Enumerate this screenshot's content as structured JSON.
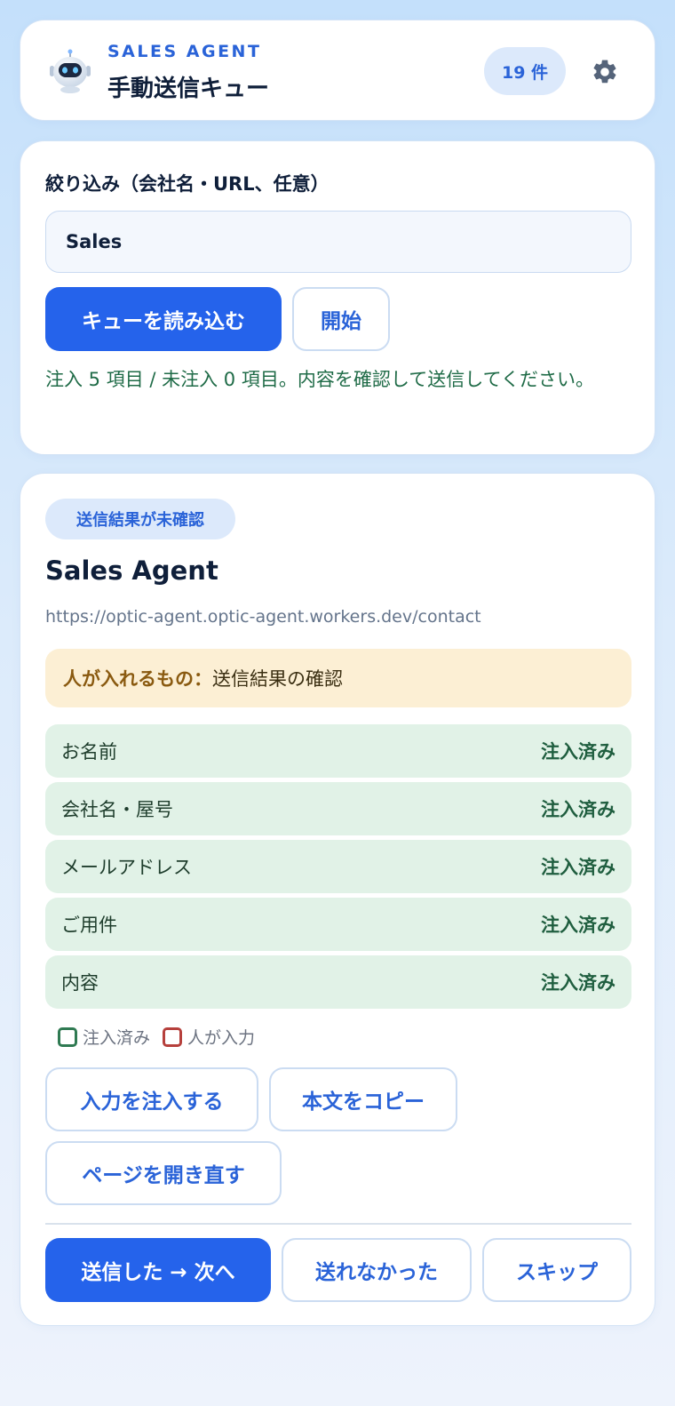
{
  "header": {
    "brand": "SALES AGENT",
    "title": "手動送信キュー",
    "count": "19 件"
  },
  "filter": {
    "label": "絞り込み（会社名・URL、任意）",
    "value": "Sales",
    "load_button": "キューを読み込む",
    "start_button": "開始",
    "status": "注入 5 項目 / 未注入 0 項目。内容を確認して送信してください。"
  },
  "item": {
    "status": "送信結果が未確認",
    "company": "Sales Agent",
    "url": "https://optic-agent.optic-agent.workers.dev/contact",
    "human_label": "人が入れるもの：",
    "human_value": "送信結果の確認",
    "fields": [
      {
        "name": "お名前",
        "status": "注入済み"
      },
      {
        "name": "会社名・屋号",
        "status": "注入済み"
      },
      {
        "name": "メールアドレス",
        "status": "注入済み"
      },
      {
        "name": "ご用件",
        "status": "注入済み"
      },
      {
        "name": "内容",
        "status": "注入済み"
      }
    ],
    "legend": {
      "injected": "注入済み",
      "human": "人が入力"
    },
    "buttons": {
      "inject": "入力を注入する",
      "copy": "本文をコピー",
      "reload": "ページを開き直す",
      "sent_next": "送信した → 次へ",
      "not_sent": "送れなかった",
      "skip": "スキップ"
    }
  },
  "colors": {
    "accent": "#2563eb",
    "injected_bg": "#e1f2e7",
    "human_bg": "#fcefd4",
    "legend_injected": "#2f7a52",
    "legend_human": "#b6403c"
  },
  "icons": {
    "logo": "robot-icon",
    "settings": "gear-icon"
  }
}
